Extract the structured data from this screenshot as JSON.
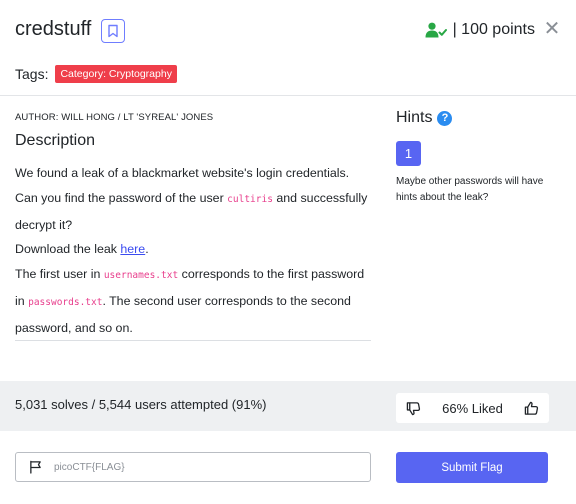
{
  "header": {
    "title": "credstuff",
    "points_label": "| 100 points",
    "close_glyph": "✕"
  },
  "tags": {
    "label": "Tags:",
    "items": [
      "Category: Cryptography"
    ]
  },
  "description": {
    "author": "AUTHOR: WILL HONG / LT 'SYREAL' JONES",
    "heading": "Description",
    "p1_a": "We found a leak of a blackmarket website's login credentials. Can you find the password of the user ",
    "p1_code": "cultiris",
    "p1_b": " and successfully decrypt it?",
    "p2_a": "Download the leak ",
    "p2_link": "here",
    "p2_b": ".",
    "p3_a": "The first user in ",
    "p3_code1": "usernames.txt",
    "p3_b": " corresponds to the first password in ",
    "p3_code2": "passwords.txt",
    "p3_c": ". The second user corresponds to the second password, and so on."
  },
  "hints": {
    "heading": "Hints",
    "items": [
      {
        "number": "1",
        "text": "Maybe other passwords will have hints about the leak?"
      }
    ]
  },
  "stats": {
    "solves": "5,031 solves / 5,544 users attempted (91%)",
    "liked": "66% Liked"
  },
  "flag": {
    "placeholder": "picoCTF{FLAG}",
    "submit_label": "Submit Flag"
  },
  "colors": {
    "accent": "#5865f2",
    "tag": "#ef3e4a",
    "code": "#e83e8c",
    "success": "#28a745"
  }
}
